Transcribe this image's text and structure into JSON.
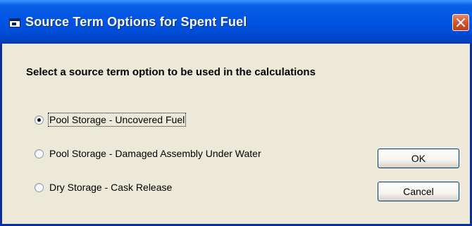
{
  "window": {
    "title": "Source Term Options for Spent Fuel"
  },
  "prompt": "Select a source term option to be used in the calculations",
  "options": [
    {
      "label": "Pool Storage - Uncovered Fuel",
      "selected": true
    },
    {
      "label": "Pool Storage - Damaged Assembly Under Water",
      "selected": false
    },
    {
      "label": "Dry Storage - Cask Release",
      "selected": false
    }
  ],
  "buttons": {
    "ok": "OK",
    "cancel": "Cancel"
  },
  "colors": {
    "titlebar": "#0054E3",
    "dialog_bg": "#ECE9D8",
    "close_button": "#D5532F"
  }
}
